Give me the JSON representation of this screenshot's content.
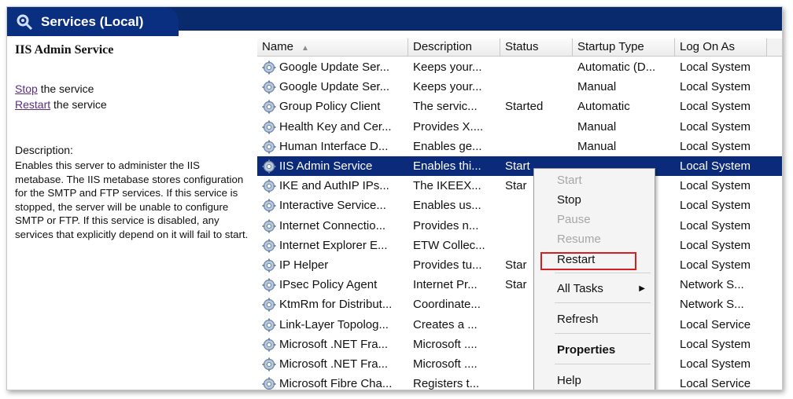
{
  "window": {
    "title": "Services (Local)"
  },
  "left": {
    "service_name": "IIS Admin Service",
    "stop_link": "Stop",
    "stop_suffix": " the service",
    "restart_link": "Restart",
    "restart_suffix": " the service",
    "description_label": "Description:",
    "description": "Enables this server to administer the IIS metabase. The IIS metabase stores configuration for the SMTP and FTP services. If this service is stopped, the server will be unable to configure SMTP or FTP. If this service is disabled, any services that explicitly depend on it will fail to start."
  },
  "table": {
    "columns": [
      "Name",
      "Description",
      "Status",
      "Startup Type",
      "Log On As"
    ],
    "rows": [
      {
        "name": "Google Update Ser...",
        "desc": "Keeps your...",
        "status": "",
        "startup": "Automatic (D...",
        "logon": "Local System"
      },
      {
        "name": "Google Update Ser...",
        "desc": "Keeps your...",
        "status": "",
        "startup": "Manual",
        "logon": "Local System"
      },
      {
        "name": "Group Policy Client",
        "desc": "The servic...",
        "status": "Started",
        "startup": "Automatic",
        "logon": "Local System"
      },
      {
        "name": "Health Key and Cer...",
        "desc": "Provides X....",
        "status": "",
        "startup": "Manual",
        "logon": "Local System"
      },
      {
        "name": "Human Interface D...",
        "desc": "Enables ge...",
        "status": "",
        "startup": "Manual",
        "logon": "Local System"
      },
      {
        "name": "IIS Admin Service",
        "desc": "Enables thi...",
        "status": "Start",
        "startup": "",
        "logon": "Local System",
        "selected": true
      },
      {
        "name": "IKE and AuthIP IPs...",
        "desc": "The IKEEX...",
        "status": "Star",
        "startup": "",
        "logon": "Local System"
      },
      {
        "name": "Interactive Service...",
        "desc": "Enables us...",
        "status": "",
        "startup": "",
        "logon": "Local System"
      },
      {
        "name": "Internet Connectio...",
        "desc": "Provides n...",
        "status": "",
        "startup": "",
        "logon": "Local System"
      },
      {
        "name": "Internet Explorer E...",
        "desc": "ETW Collec...",
        "status": "",
        "startup": "",
        "logon": "Local System"
      },
      {
        "name": "IP Helper",
        "desc": "Provides tu...",
        "status": "Star",
        "startup": "",
        "logon": "Local System"
      },
      {
        "name": "IPsec Policy Agent",
        "desc": "Internet Pr...",
        "status": "Star",
        "startup": "",
        "logon": "Network S..."
      },
      {
        "name": "KtmRm for Distribut...",
        "desc": "Coordinate...",
        "status": "",
        "startup": "",
        "logon": "Network S..."
      },
      {
        "name": "Link-Layer Topolog...",
        "desc": "Creates a ...",
        "status": "",
        "startup": "",
        "logon": "Local Service"
      },
      {
        "name": "Microsoft .NET Fra...",
        "desc": "Microsoft ....",
        "status": "",
        "startup": "",
        "logon": "Local System"
      },
      {
        "name": "Microsoft .NET Fra...",
        "desc": "Microsoft ....",
        "status": "",
        "startup": "",
        "logon": "Local System"
      },
      {
        "name": "Microsoft Fibre Cha...",
        "desc": "Registers t...",
        "status": "",
        "startup": "",
        "logon": "Local Service"
      }
    ]
  },
  "context_menu": {
    "start": "Start",
    "stop": "Stop",
    "pause": "Pause",
    "resume": "Resume",
    "restart": "Restart",
    "all_tasks": "All Tasks",
    "refresh": "Refresh",
    "properties": "Properties",
    "help": "Help"
  },
  "icons": {
    "title": "services-icon",
    "row": "gear-icon",
    "submenu": "triangle-right-icon"
  },
  "colors": {
    "title_bar": "#0a2a6e",
    "selection": "#0b2b7a",
    "highlight_box": "#d42020",
    "link": "#5a2d82"
  }
}
